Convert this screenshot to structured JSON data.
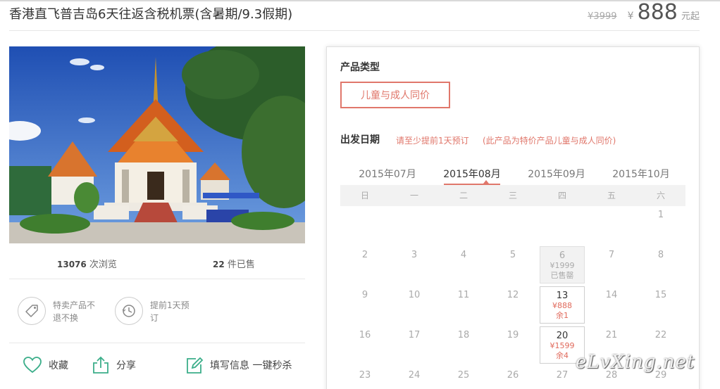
{
  "header": {
    "title": "香港直飞普吉岛6天往返含税机票(含暑期/9.3假期)",
    "old_price": "¥3999",
    "currency": "¥",
    "price": "888",
    "unit": "元起"
  },
  "stats": {
    "views_count": "13076",
    "views_label": "次浏览",
    "sold_count": "22",
    "sold_label": "件已售"
  },
  "features": [
    {
      "icon": "tag-icon",
      "text": "特卖产品不退不换"
    },
    {
      "icon": "clock-icon",
      "text": "提前1天预订"
    }
  ],
  "actions": {
    "favorite": "收藏",
    "share": "分享",
    "fill_info": "填写信息 一键秒杀"
  },
  "panel": {
    "product_type_label": "产品类型",
    "product_type_option": "儿童与成人同价",
    "depart_label": "出发日期",
    "depart_note1": "请至少提前1天预订",
    "depart_note2": "(此产品为特价产品儿童与成人同价)",
    "months": [
      "2015年07月",
      "2015年08月",
      "2015年09月",
      "2015年10月"
    ],
    "active_month_index": 1,
    "weekdays": [
      "日",
      "一",
      "二",
      "三",
      "四",
      "五",
      "六"
    ],
    "days": [
      {
        "day": "1",
        "row": 0,
        "col": 6
      },
      {
        "day": "2",
        "row": 1,
        "col": 0
      },
      {
        "day": "3",
        "row": 1,
        "col": 1
      },
      {
        "day": "4",
        "row": 1,
        "col": 2
      },
      {
        "day": "5",
        "row": 1,
        "col": 3
      },
      {
        "day": "6",
        "row": 1,
        "col": 4,
        "status": "soldout",
        "price": "¥1999",
        "note": "已售罄"
      },
      {
        "day": "7",
        "row": 1,
        "col": 5
      },
      {
        "day": "8",
        "row": 1,
        "col": 6
      },
      {
        "day": "9",
        "row": 2,
        "col": 0
      },
      {
        "day": "10",
        "row": 2,
        "col": 1
      },
      {
        "day": "11",
        "row": 2,
        "col": 2
      },
      {
        "day": "12",
        "row": 2,
        "col": 3
      },
      {
        "day": "13",
        "row": 2,
        "col": 4,
        "status": "avail",
        "price": "¥888",
        "note": "余1"
      },
      {
        "day": "14",
        "row": 2,
        "col": 5
      },
      {
        "day": "15",
        "row": 2,
        "col": 6
      },
      {
        "day": "16",
        "row": 3,
        "col": 0
      },
      {
        "day": "17",
        "row": 3,
        "col": 1
      },
      {
        "day": "18",
        "row": 3,
        "col": 2
      },
      {
        "day": "19",
        "row": 3,
        "col": 3
      },
      {
        "day": "20",
        "row": 3,
        "col": 4,
        "status": "avail",
        "price": "¥1599",
        "note": "余4"
      },
      {
        "day": "21",
        "row": 3,
        "col": 5
      },
      {
        "day": "22",
        "row": 3,
        "col": 6
      },
      {
        "day": "23",
        "row": 4,
        "col": 0
      },
      {
        "day": "24",
        "row": 4,
        "col": 1
      },
      {
        "day": "25",
        "row": 4,
        "col": 2
      },
      {
        "day": "26",
        "row": 4,
        "col": 3
      },
      {
        "day": "27",
        "row": 4,
        "col": 4
      },
      {
        "day": "28",
        "row": 4,
        "col": 5
      },
      {
        "day": "29",
        "row": 4,
        "col": 6
      }
    ]
  },
  "watermark": "eLvXing.net",
  "colors": {
    "accent": "#e0776b",
    "green_icon": "#3cae8a"
  }
}
